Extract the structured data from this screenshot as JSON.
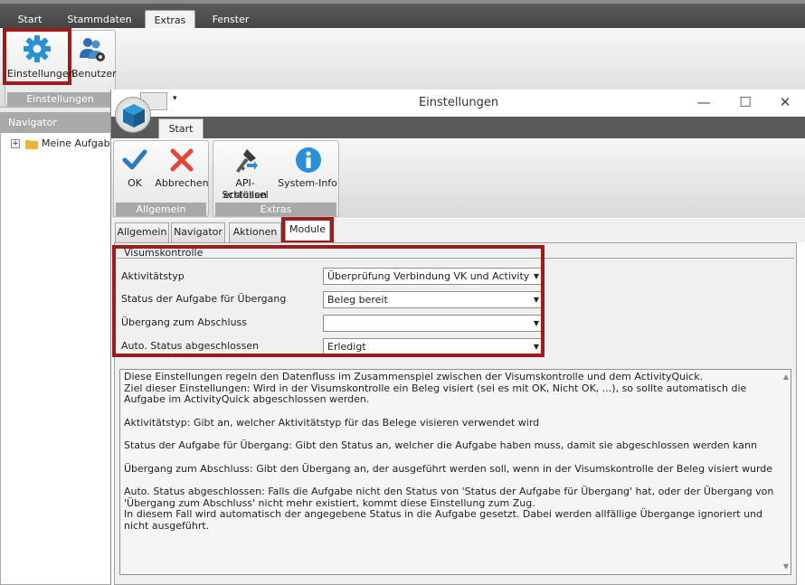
{
  "main_menu": {
    "tabs": [
      "Start",
      "Stammdaten",
      "Extras",
      "Fenster"
    ],
    "active": "Extras"
  },
  "main_ribbon": {
    "einstellungen_label": "Einstellungen",
    "benutzer_label": "Benutzer",
    "group_caption": "Einstellungen"
  },
  "navigator": {
    "title": "Navigator",
    "item_label": "Meine Aufgaben"
  },
  "dialog": {
    "title": "Einstellungen",
    "ribbon_tab": "Start",
    "ok_label": "OK",
    "abbrechen_label": "Abbrechen",
    "group_allgemein": "Allgemein",
    "api_label_1": "API-Schlüssel",
    "api_label_2": "erstellen",
    "sysinfo_label": "System-Info",
    "group_extras": "Extras"
  },
  "form_tabs": [
    "Allgemein",
    "Navigator",
    "Aktionen",
    "Module"
  ],
  "visumskontrolle": {
    "title": "Visumskontrolle",
    "rows": [
      {
        "label": "Aktivitätstyp",
        "value": "Überprüfung Verbindung VK und Activity"
      },
      {
        "label": "Status der Aufgabe für Übergang",
        "value": "Beleg bereit"
      },
      {
        "label": "Übergang zum Abschluss",
        "value": ""
      },
      {
        "label": "Auto. Status abgeschlossen",
        "value": "Erledigt"
      }
    ]
  },
  "description": [
    "Diese Einstellungen regeln den Datenfluss im Zusammenspiel zwischen der Visumskontrolle und dem ActivityQuick.",
    "Ziel dieser Einstellungen: Wird in der Visumskontrolle ein Beleg visiert (sei es mit OK, Nicht OK, ...), so sollte automatisch die Aufgabe im ActivityQuick abgeschlossen werden.",
    "",
    "Aktivitätstyp: Gibt an, welcher Aktivitätstyp für das Belege visieren verwendet wird",
    "",
    "Status der Aufgabe für Übergang: Gibt den Status an, welcher die Aufgabe haben muss, damit sie abgeschlossen werden kann",
    "",
    "Übergang zum Abschluss: Gibt den Übergang an, der ausgeführt werden soll, wenn in der Visumskontrolle der Beleg visiert wurde",
    "",
    "Auto. Status abgeschlossen: Falls die Aufgabe nicht den Status von 'Status der Aufgabe für Übergang' hat, oder der Übergang von 'Übergang zum Abschluss' nicht mehr existiert, kommt diese Einstellung zum Zug.",
    "In diesem Fall wird automatisch der angegebene Status in die Aufgabe gesetzt. Dabei werden allfällige Übergange ignoriert und nicht ausgeführt."
  ]
}
